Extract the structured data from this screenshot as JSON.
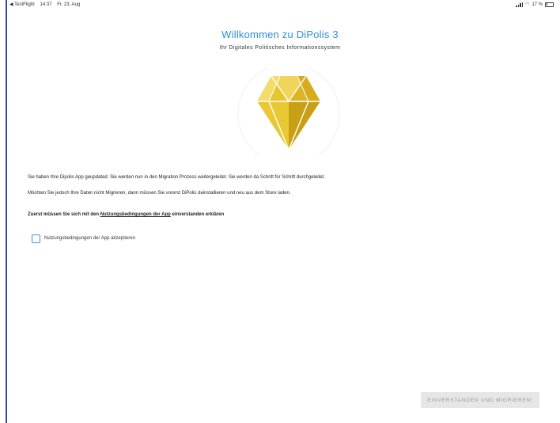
{
  "status_bar": {
    "back_app": "◀ TestFlight",
    "time": "14:37",
    "date": "Fr. 23. Aug",
    "battery": "17 %"
  },
  "welcome": {
    "title": "Willkommen zu DiPolis 3",
    "subtitle": "Ihr Digitales Politisches Informationssystem"
  },
  "logo": {
    "icon": "diamond-logo-icon",
    "colors": [
      "#f0d04a",
      "#e2bf2c",
      "#d4a91c",
      "#c9a01a"
    ]
  },
  "body": {
    "paragraph_1": "Sie haben Ihre Dipolis App geupdated. Sie werden nun in den Migration Prozess weitergeleitet. Sie werden da Schritt für Schritt durchgeleitet.",
    "paragraph_2": "Möchten Sie jedoch Ihre Daten nicht Migrieren, dann müssen Sie vorerst DiPolis deinstallieren und neu aus dem Store laden.",
    "terms_prefix": "Zuerst müssen Sie sich mit den ",
    "terms_link": "Nutzungsbedingungen der App",
    "terms_suffix": " einverstanden erklären"
  },
  "checkbox": {
    "label": "Nutzungsbedingungen der App akzeptieren",
    "checked": false
  },
  "submit_button": {
    "label": "EINVERSTANDEN UND MIGRIEREN!",
    "enabled": false
  },
  "colors": {
    "accent": "#2f8fd6",
    "checkbox_border": "#4a90d9",
    "button_disabled_bg": "#e6e6e6"
  }
}
